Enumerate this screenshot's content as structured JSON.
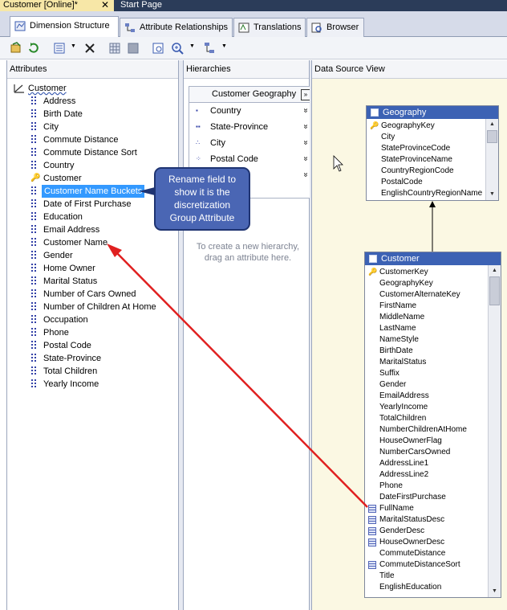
{
  "doc_tabs": {
    "active": "Customer [Online]*",
    "close": "✕",
    "other": "Start Page"
  },
  "designer_tabs": [
    "Dimension Structure",
    "Attribute Relationships",
    "Translations",
    "Browser"
  ],
  "attributes_pane": {
    "header": "Attributes",
    "root": "Customer",
    "items": [
      "Address",
      "Birth Date",
      "City",
      "Commute Distance",
      "Commute Distance Sort",
      "Country",
      "Customer",
      "Customer Name Buckets",
      "Date of First Purchase",
      "Education",
      "Email Address",
      "Customer Name",
      "Gender",
      "Home Owner",
      "Marital Status",
      "Number of Cars Owned",
      "Number of Children At Home",
      "Occupation",
      "Phone",
      "Postal Code",
      "State-Province",
      "Total Children",
      "Yearly Income"
    ],
    "selected": "Customer Name Buckets"
  },
  "hierarchies_pane": {
    "header": "Hierarchies",
    "hierarchy_title": "Customer Geography",
    "levels": [
      "Country",
      "State-Province",
      "City",
      "Postal Code",
      ""
    ],
    "hint": "To create a new hierarchy, drag an attribute here."
  },
  "dsv_pane": {
    "header": "Data Source View",
    "geography": {
      "title": "Geography",
      "columns": [
        "GeographyKey",
        "City",
        "StateProvinceCode",
        "StateProvinceName",
        "CountryRegionCode",
        "PostalCode",
        "EnglishCountryRegionName"
      ]
    },
    "customer": {
      "title": "Customer",
      "columns": [
        "CustomerKey",
        "GeographyKey",
        "CustomerAlternateKey",
        "FirstName",
        "MiddleName",
        "LastName",
        "NameStyle",
        "BirthDate",
        "MaritalStatus",
        "Suffix",
        "Gender",
        "EmailAddress",
        "YearlyIncome",
        "TotalChildren",
        "NumberChildrenAtHome",
        "HouseOwnerFlag",
        "NumberCarsOwned",
        "AddressLine1",
        "AddressLine2",
        "Phone",
        "DateFirstPurchase",
        "FullName",
        "MaritalStatusDesc",
        "GenderDesc",
        "HouseOwnerDesc",
        "CommuteDistance",
        "CommuteDistanceSort",
        "Title",
        "EnglishEducation"
      ]
    }
  },
  "callout": {
    "lines": [
      "Rename field to",
      "show it is the",
      "discretization",
      "Group Attribute"
    ]
  },
  "colors": {
    "accent": "#3399ff",
    "table_header": "#3c62b4",
    "callout": "#4a66b4",
    "arrow": "#e02020"
  }
}
